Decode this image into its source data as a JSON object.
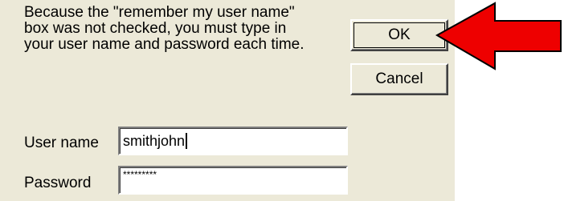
{
  "dialog": {
    "message_lines": [
      "Because the \"remember my user name\"",
      "box was not checked, you must type in",
      "your user name and password each time."
    ],
    "ok_label": "OK",
    "cancel_label": "Cancel",
    "username_label": "User name",
    "username_value": "smithjohn",
    "password_label": "Password",
    "password_mask": "*********"
  },
  "annotation": {
    "arrow_icon": "red-arrow-icon",
    "arrow_color": "#ee0000",
    "points_to": "OK button"
  },
  "colors": {
    "dialog_background": "#ece9d8"
  }
}
